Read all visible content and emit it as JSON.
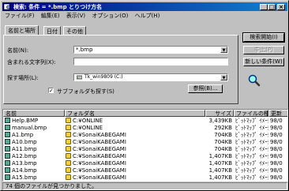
{
  "window": {
    "title": "検索: 条件 = *.bmp とりつけ方名"
  },
  "menu": [
    "ファイル(F)",
    "編集(E)",
    "表示(V)",
    "オプション(O)",
    "ヘルプ(H)"
  ],
  "tabs": [
    "名前と場所",
    "日付",
    "その他"
  ],
  "form": {
    "name_label": "名前(N):",
    "name_value": "*.bmp",
    "text_label": "含まれる文字列(X):",
    "text_value": "",
    "location_label": "探す場所(L):",
    "location_value": "Tk_win9809 (C:)",
    "subfolder_label": "サブフォルダも探す(S)",
    "browse_label": "参照(B)..."
  },
  "buttons": {
    "find": "検索開始(I)",
    "stop": "中止(P)",
    "new": "新しい条件(W)"
  },
  "icons": {
    "magnifier": "magnifier-icon",
    "image_file": "bitmap-file-icon",
    "folder": "folder-icon"
  },
  "columns": [
    "名前",
    "フォルダ名",
    "サイズ",
    "ファイルの種類",
    "更新"
  ],
  "rows": [
    {
      "name": "Help.BMP",
      "folder": "C:¥ONLINE",
      "size": "3,439KB",
      "type": "ﾋﾞｯﾄﾏｯﾌﾟ ｲﾒｰｼﾞ",
      "date": "98/0"
    },
    {
      "name": "manual.bmp",
      "folder": "C:¥ONLINE",
      "size": "292KB",
      "type": "ﾋﾞｯﾄﾏｯﾌﾟ ｲﾒｰｼﾞ",
      "date": "98/0"
    },
    {
      "name": "A1.bmp",
      "folder": "C:¥SonaiKABEGAMI",
      "size": "704KB",
      "type": "ﾋﾞｯﾄﾏｯﾌﾟ ｲﾒｰｼﾞ",
      "date": "98/0"
    },
    {
      "name": "A10.bmp",
      "folder": "C:¥SonaiKABEGAMI",
      "size": "704KB",
      "type": "ﾋﾞｯﾄﾏｯﾌﾟ ｲﾒｰｼﾞ",
      "date": "98/0"
    },
    {
      "name": "A11.bmp",
      "folder": "C:¥SonaiKABEGAMI",
      "size": "704KB",
      "type": "ﾋﾞｯﾄﾏｯﾌﾟ ｲﾒｰｼﾞ",
      "date": "98/0"
    },
    {
      "name": "A12.bmp",
      "folder": "C:¥SonaiKABEGAMI",
      "size": "1,407KB",
      "type": "ﾋﾞｯﾄﾏｯﾌﾟ ｲﾒｰｼﾞ",
      "date": "98/0"
    },
    {
      "name": "A13.bmp",
      "folder": "C:¥SonaiKABEGAMI",
      "size": "1,407KB",
      "type": "ﾋﾞｯﾄﾏｯﾌﾟ ｲﾒｰｼﾞ",
      "date": "98/0"
    },
    {
      "name": "A14.bmp",
      "folder": "C:¥SonaiKABEGAMI",
      "size": "1,407KB",
      "type": "ﾋﾞｯﾄﾏｯﾌﾟ ｲﾒｰｼﾞ",
      "date": "98/0"
    },
    {
      "name": "A15.bmp",
      "folder": "C:¥SonaiKABEGAMI",
      "size": "1,407KB",
      "type": "ﾋﾞｯﾄﾏｯﾌﾟ ｲﾒｰｼﾞ",
      "date": "98/0"
    }
  ],
  "status": "74 個のファイルが見つかりました。"
}
